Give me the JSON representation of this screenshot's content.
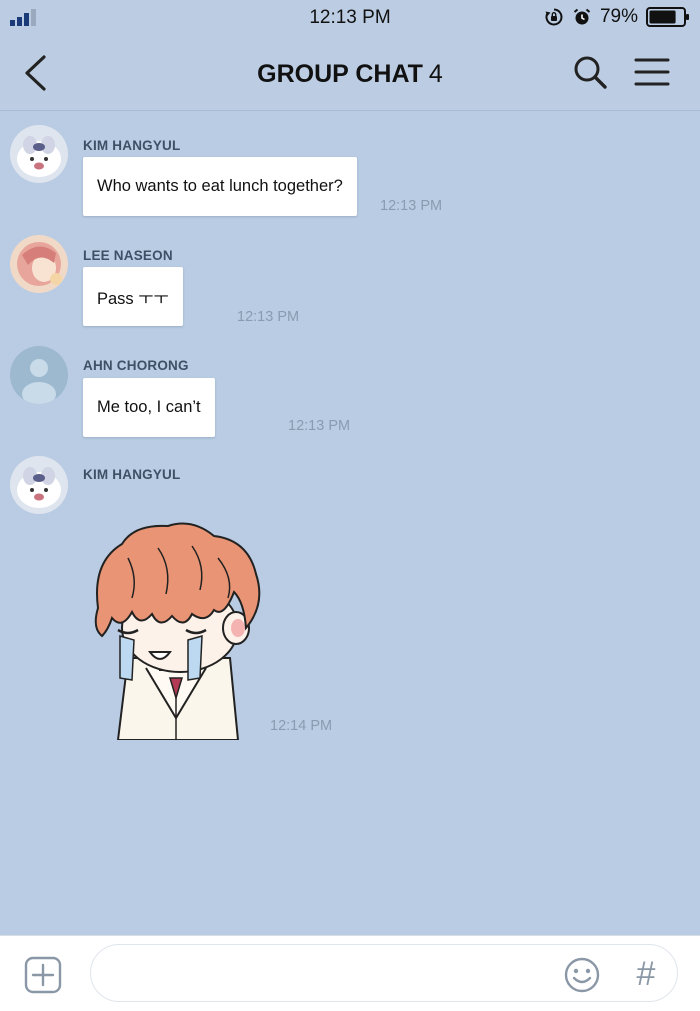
{
  "status_bar": {
    "time": "12:13 PM",
    "battery_percent": "79%",
    "battery_level": 0.79,
    "icons": [
      "signal-icon",
      "rotation-lock-icon",
      "alarm-icon",
      "battery-icon"
    ]
  },
  "header": {
    "title": "GROUP CHAT",
    "member_count": "4",
    "icons": [
      "back-arrow-icon",
      "search-icon",
      "menu-icon"
    ]
  },
  "messages": [
    {
      "sender": "KIM HANGYUL",
      "text": "Who wants to eat lunch together?",
      "time": "12:13 PM"
    },
    {
      "sender": "LEE NASEON",
      "text": "Pass ㅜㅜ",
      "time": "12:13 PM"
    },
    {
      "sender": "AHN CHORONG",
      "text": "Me too, I can’t",
      "time": "12:13 PM"
    },
    {
      "sender": "KIM HANGYUL",
      "sticker": "crying-boy-sticker",
      "time": "12:14 PM"
    }
  ],
  "input_bar": {
    "placeholder": "",
    "icons": [
      "plus-icon",
      "emoji-icon",
      "hashtag-icon"
    ],
    "hash_symbol": "#"
  },
  "colors": {
    "background": "#b9cce3",
    "bubble": "#ffffff",
    "sender_text": "#3f5066",
    "timestamp": "#8a9bb1"
  }
}
